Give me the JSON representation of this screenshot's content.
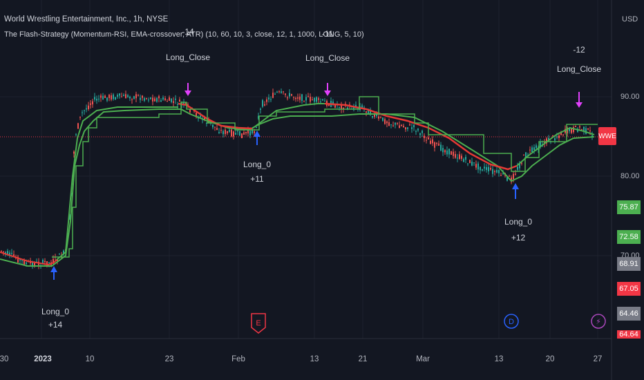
{
  "header": {
    "title": "World Wrestling Entertainment, Inc., 1h, NYSE",
    "indicator": "The Flash-Strategy (Momentum-RSI, EMA-crossover, ATR) (10, 60, 10, 3, close, 12, 1, 1000, LONG, 5, 10)",
    "currency": "USD"
  },
  "price_axis": {
    "labels": [
      "90.00",
      "80.00",
      "70.00"
    ],
    "tags": [
      {
        "value": "75.87",
        "color": "#4caf50"
      },
      {
        "value": "72.58",
        "color": "#4caf50"
      },
      {
        "value": "68.91",
        "color": "#787b86"
      },
      {
        "value": "67.05",
        "color": "#f23645"
      },
      {
        "value": "64.46",
        "color": "#787b86"
      },
      {
        "value": "64.64",
        "color": "#f23645"
      }
    ]
  },
  "symbol_tag": "WWE",
  "time_axis": {
    "labels": [
      "30",
      "2023",
      "10",
      "23",
      "Feb",
      "13",
      "21",
      "Mar",
      "13",
      "20",
      "27"
    ]
  },
  "trades": [
    {
      "entry_label": "Long_0",
      "entry_qty": "+14",
      "exit_label": "Long_Close",
      "exit_qty": "-14"
    },
    {
      "entry_label": "Long_0",
      "entry_qty": "+11",
      "exit_label": "Long_Close",
      "exit_qty": "-11"
    },
    {
      "entry_label": "Long_0",
      "entry_qty": "+12",
      "exit_label": "Long_Close",
      "exit_qty": "-12"
    }
  ],
  "events": [
    {
      "icon": "earnings-icon",
      "letter": "E",
      "color": "#f23645"
    },
    {
      "icon": "dividend-icon",
      "letter": "D",
      "color": "#2962ff"
    },
    {
      "icon": "flash-icon",
      "letter": "⚡",
      "color": "#ab47bc"
    }
  ],
  "colors": {
    "up": "#26a69a",
    "down": "#ef5350",
    "ema_green": "#4caf50",
    "ema_red": "#e53935",
    "price_line": "#f23645"
  }
}
